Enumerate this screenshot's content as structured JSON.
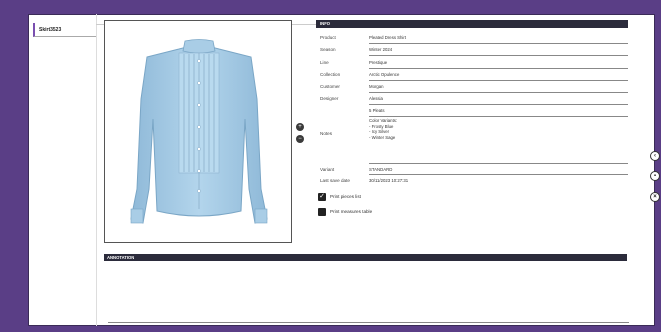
{
  "sidebar": {
    "tab_label": "Skirt3523"
  },
  "info": {
    "title": "INFO",
    "fields": [
      {
        "label": "Product",
        "value": "Pleated Dress Shirt"
      },
      {
        "label": "Season",
        "value": "Winter 2024"
      },
      {
        "label": "Line",
        "value": "Prestique"
      },
      {
        "label": "Collection",
        "value": "Arctic Opulence"
      },
      {
        "label": "Customer",
        "value": "Morgan"
      },
      {
        "label": "Designer",
        "value": "Alessia"
      },
      {
        "label": "",
        "value": "5 Pleats"
      }
    ],
    "notes": {
      "label": "Notes",
      "lines": [
        "Color Variants:",
        "- Frosty Blue",
        "- Icy Silver",
        "- Winter Sage"
      ]
    },
    "variant": {
      "label": "Variant",
      "value": "STANDARD"
    },
    "last_save": {
      "label": "Last save date",
      "value": "30/11/2023 10:27:31"
    }
  },
  "checks": {
    "print_pieces": {
      "label": "Print pieces list",
      "checked": true
    },
    "print_measures": {
      "label": "Print measures table",
      "checked": false
    }
  },
  "annotation": {
    "title": "ANNOTATION",
    "text": ""
  },
  "image": {
    "subject": "light blue pleated dress shirt",
    "color": "#a9cfe8"
  }
}
